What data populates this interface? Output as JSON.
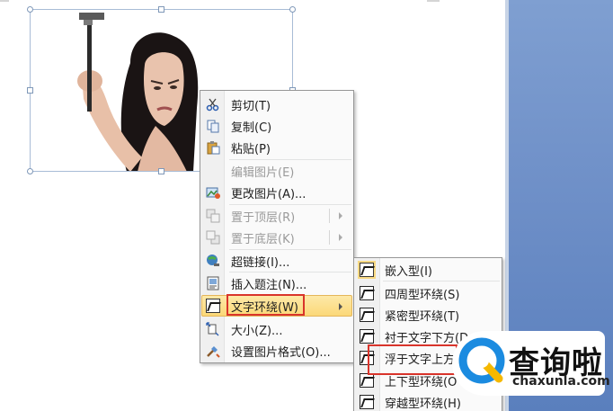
{
  "context_menu": {
    "items": [
      {
        "id": "cut",
        "label": "剪切(T)",
        "icon": "scissors-icon",
        "enabled": true
      },
      {
        "id": "copy",
        "label": "复制(C)",
        "icon": "copy-icon",
        "enabled": true
      },
      {
        "id": "paste",
        "label": "粘贴(P)",
        "icon": "paste-icon",
        "enabled": true
      },
      {
        "id": "edit-picture",
        "label": "编辑图片(E)",
        "icon": "",
        "enabled": false
      },
      {
        "id": "change-picture",
        "label": "更改图片(A)...",
        "icon": "change-picture-icon",
        "enabled": true
      },
      {
        "id": "bring-to-front",
        "label": "置于顶层(R)",
        "icon": "bring-front-icon",
        "enabled": false
      },
      {
        "id": "send-to-back",
        "label": "置于底层(K)",
        "icon": "send-back-icon",
        "enabled": false
      },
      {
        "id": "hyperlink",
        "label": "超链接(I)...",
        "icon": "hyperlink-icon",
        "enabled": true
      },
      {
        "id": "insert-caption",
        "label": "插入题注(N)...",
        "icon": "caption-icon",
        "enabled": true
      },
      {
        "id": "text-wrapping",
        "label": "文字环绕(W)",
        "icon": "text-wrap-icon",
        "enabled": true
      },
      {
        "id": "size",
        "label": "大小(Z)...",
        "icon": "size-icon",
        "enabled": true
      },
      {
        "id": "format-picture",
        "label": "设置图片格式(O)...",
        "icon": "format-picture-icon",
        "enabled": true
      }
    ]
  },
  "wrap_submenu": {
    "items": [
      {
        "id": "inline",
        "label": "嵌入型(I)"
      },
      {
        "id": "square",
        "label": "四周型环绕(S)"
      },
      {
        "id": "tight",
        "label": "紧密型环绕(T)"
      },
      {
        "id": "behind",
        "label": "衬于文字下方(D"
      },
      {
        "id": "front",
        "label": "浮于文字上方"
      },
      {
        "id": "top-bottom",
        "label": "上下型环绕(O"
      },
      {
        "id": "through",
        "label": "穿越型环绕(H)"
      }
    ]
  },
  "watermark": {
    "logo_text": "查询啦",
    "domain": "chaxunla.com"
  },
  "colors": {
    "accent_red": "#d9342b",
    "highlight": "#fbd878",
    "side_panel": "#6f90c8",
    "watermark_blue": "#1b8be0",
    "watermark_yellow": "#f5b800"
  }
}
